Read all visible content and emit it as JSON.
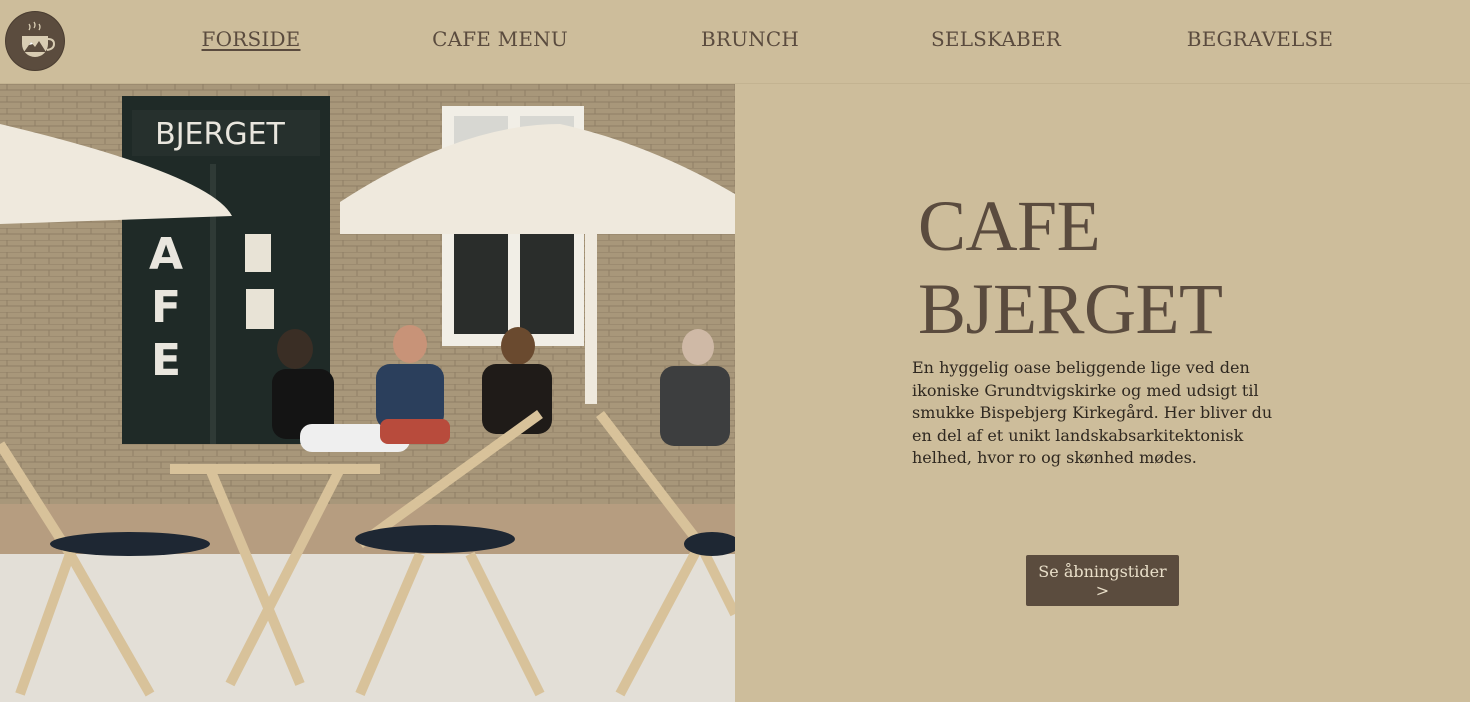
{
  "nav": {
    "items": [
      {
        "label": "FORSIDE",
        "active": true
      },
      {
        "label": "CAFE MENU",
        "active": false
      },
      {
        "label": "BRUNCH",
        "active": false
      },
      {
        "label": "SELSKABER",
        "active": false
      },
      {
        "label": "BEGRAVELSE",
        "active": false
      }
    ]
  },
  "logo": {
    "icon": "mountain-coffee-icon"
  },
  "hero": {
    "photo": {
      "sign_text": "BJERGET",
      "door_letters": [
        "A",
        "F",
        "E"
      ]
    },
    "title": "CAFE BJERGET",
    "description": "En hyggelig oase beliggende lige ved den ikoniske Grundtvigskirke og med udsigt til smukke Bispebjerg Kirkegård. Her bliver du en del af et unikt landskabsarkitektonisk helhed, hvor ro og skønhed mødes.",
    "button_label": "Se åbningstider >"
  },
  "colors": {
    "background": "#cdbd9b",
    "accent": "#5b4c3e",
    "text": "#5a4b3e"
  }
}
